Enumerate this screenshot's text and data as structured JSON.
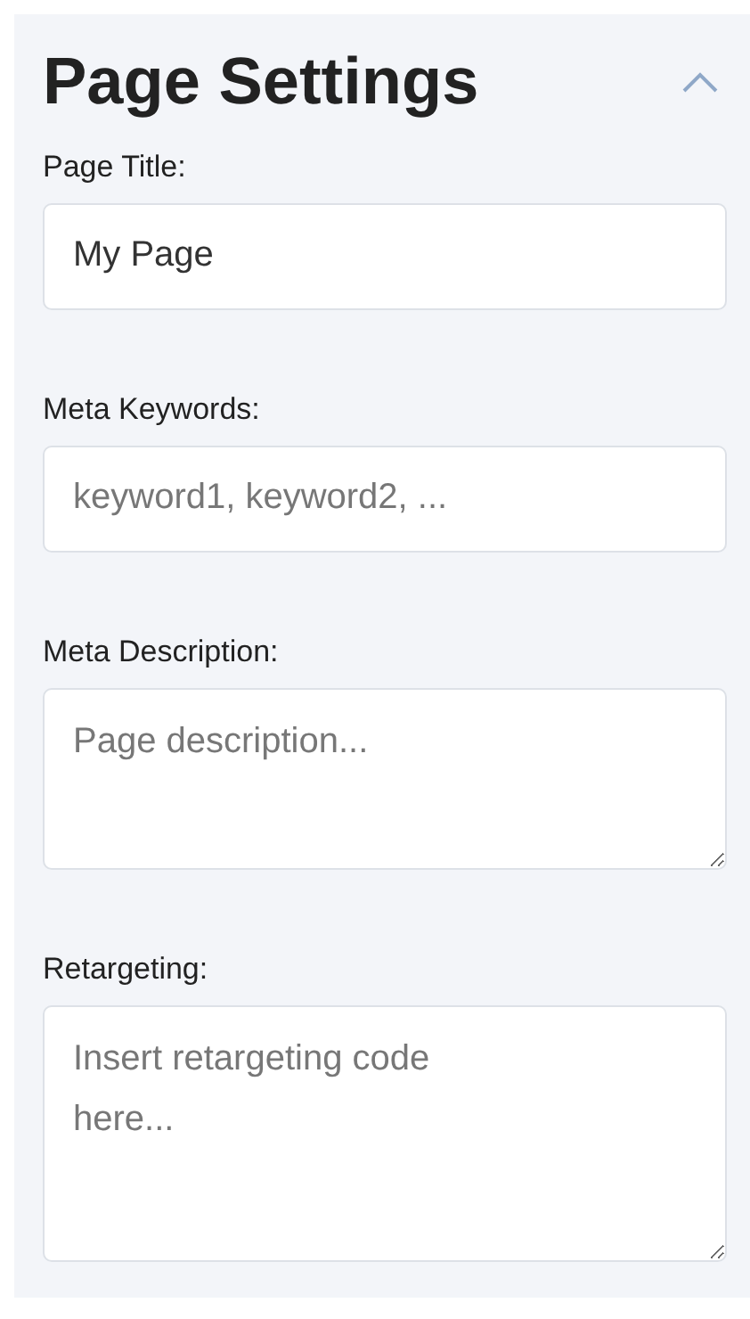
{
  "panel": {
    "title": "Page Settings",
    "expanded": true
  },
  "fields": [
    {
      "kind": "input",
      "label": "Page Title:",
      "value": "My Page"
    },
    {
      "kind": "input",
      "label": "Meta Keywords:",
      "placeholder": "keyword1, keyword2, ..."
    },
    {
      "kind": "textarea",
      "label": "Meta Description:",
      "placeholder": "Page description...",
      "tall": false
    },
    {
      "kind": "textarea",
      "label": "Retargeting:",
      "placeholder": "Insert retargeting code here...",
      "tall": true
    }
  ]
}
